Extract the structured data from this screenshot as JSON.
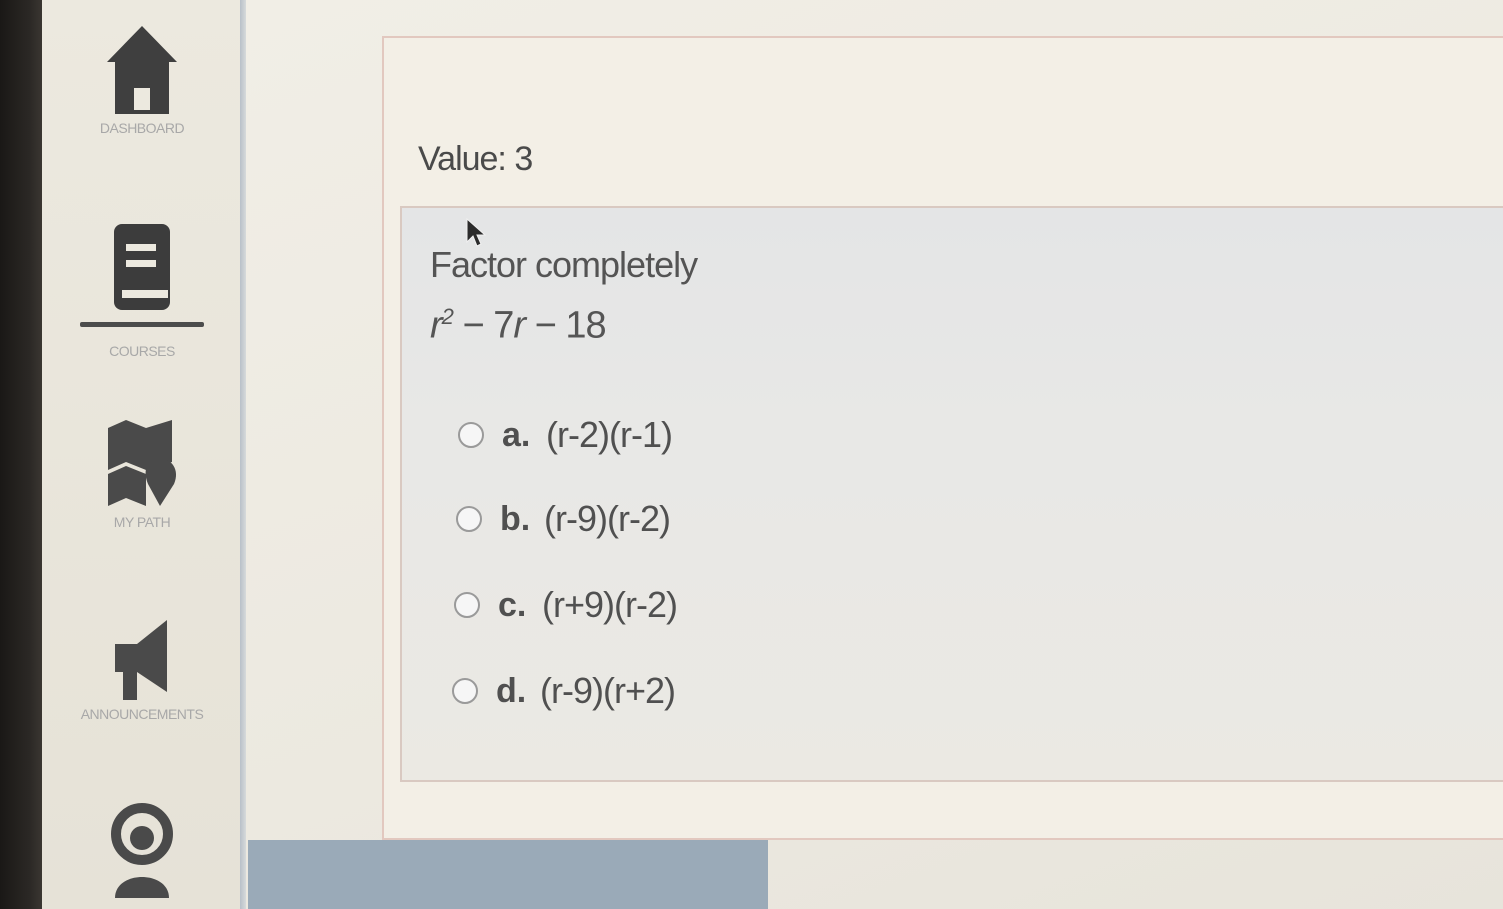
{
  "sidebar": {
    "items": [
      {
        "label": "DASHBOARD",
        "icon": "home-icon"
      },
      {
        "label": "COURSES",
        "icon": "book-icon",
        "active": true
      },
      {
        "label": "MY PATH",
        "icon": "map-icon"
      },
      {
        "label": "ANNOUNCEMENTS",
        "icon": "megaphone-icon"
      },
      {
        "label": "",
        "icon": "help-icon"
      }
    ]
  },
  "question": {
    "value_label": "Value: 3",
    "prompt": "Factor completely",
    "expression": {
      "var": "r",
      "exp": "2",
      "rest_a": " − 7",
      "rest_var": "r",
      "rest_b": " − 18"
    },
    "options": [
      {
        "letter": "a.",
        "text": "(r-2)(r-1)"
      },
      {
        "letter": "b.",
        "text": "(r-9)(r-2)"
      },
      {
        "letter": "c.",
        "text": "(r+9)(r-2)"
      },
      {
        "letter": "d.",
        "text": "(r-9)(r+2)"
      }
    ]
  },
  "colors": {
    "sidebar_label": "#a8a8a8",
    "icon": "#4a4a4a",
    "card_border": "#e2c8bf"
  }
}
